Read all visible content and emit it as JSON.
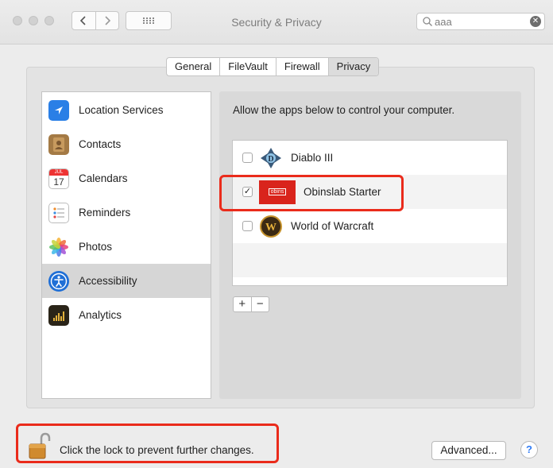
{
  "window": {
    "title": "Security & Privacy",
    "search_value": "aaa",
    "search_icon": "magnifier",
    "clear_icon": "clear-x"
  },
  "tabs": [
    {
      "label": "General",
      "selected": false
    },
    {
      "label": "FileVault",
      "selected": false
    },
    {
      "label": "Firewall",
      "selected": false
    },
    {
      "label": "Privacy",
      "selected": true
    }
  ],
  "sidebar": {
    "items": [
      {
        "label": "Location Services",
        "icon": "location-arrow-icon"
      },
      {
        "label": "Contacts",
        "icon": "contacts-book-icon"
      },
      {
        "label": "Calendars",
        "icon": "calendar-icon",
        "icon_month": "JUL",
        "icon_day": "17"
      },
      {
        "label": "Reminders",
        "icon": "reminders-list-icon"
      },
      {
        "label": "Photos",
        "icon": "photos-flower-icon"
      },
      {
        "label": "Accessibility",
        "icon": "accessibility-figure-icon",
        "selected": true
      },
      {
        "label": "Analytics",
        "icon": "analytics-chart-icon"
      }
    ]
  },
  "privacy_panel": {
    "description": "Allow the apps below to control your computer.",
    "apps": [
      {
        "label": "Diablo III",
        "checked": false,
        "icon": "diablo-icon"
      },
      {
        "label": "Obinslab Starter",
        "checked": true,
        "icon": "obinslab-icon",
        "icon_text": "obins"
      },
      {
        "label": "World of Warcraft",
        "checked": false,
        "icon": "warcraft-icon",
        "icon_letter": "W"
      }
    ],
    "add_label": "+",
    "remove_label": "−"
  },
  "footer": {
    "lock_text": "Click the lock to prevent further changes.",
    "advanced_label": "Advanced...",
    "help_label": "?"
  },
  "colors": {
    "annotation": "#ea2b1b",
    "help_accent": "#2f7bf5",
    "selected_row": "#d6d6d6"
  }
}
